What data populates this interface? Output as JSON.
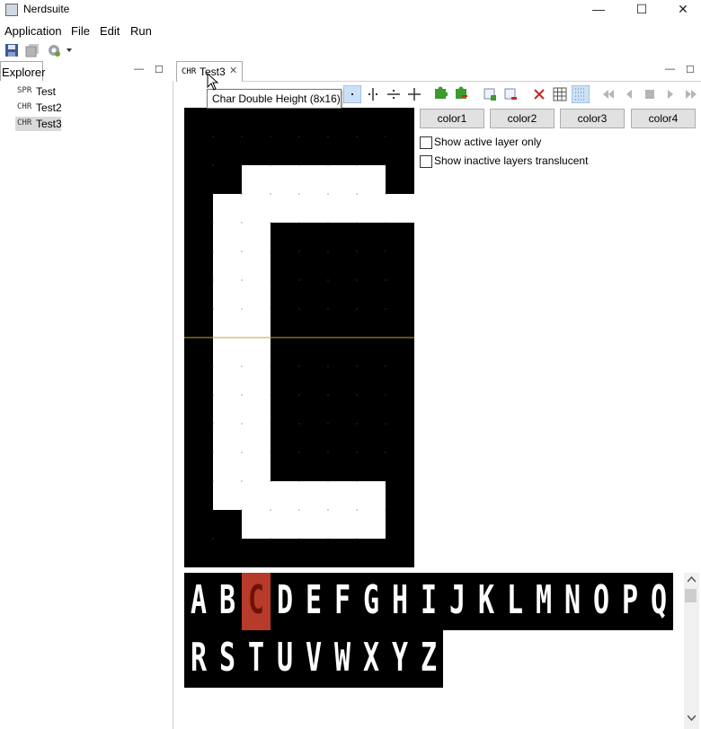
{
  "window": {
    "title": "Nerdsuite",
    "minimize_glyph": "—",
    "maximize_glyph": "☐",
    "close_glyph": "✕"
  },
  "menu": [
    "Application",
    "File",
    "Edit",
    "Run"
  ],
  "toolbar_icons": [
    "save-icon",
    "save-all-icon",
    "run-config-icon",
    "dropdown-arrow-icon"
  ],
  "explorer": {
    "tab_label": "Explorer",
    "minimize_glyph": "—",
    "maximize_glyph": "☐",
    "items": [
      {
        "tag": "SPR",
        "name": "Test"
      },
      {
        "tag": "CHR",
        "name": "Test2"
      },
      {
        "tag": "CHR",
        "name": "Test3"
      }
    ]
  },
  "editor": {
    "tab_tag": "CHR",
    "tab_name": "Test3",
    "tab_close_glyph": "✕",
    "minimize_glyph": "—",
    "maximize_glyph": "☐",
    "tooltip": "Char Double Height (8x16)",
    "color_buttons": [
      "color1",
      "color2",
      "color3",
      "color4"
    ],
    "options": [
      "Show active layer only",
      "Show inactive layers translucent"
    ],
    "toolbar_icons": [
      "pixel-tool-icon",
      "mirror-vertical-icon",
      "mirror-horizontal-icon",
      "mirror-both-icon",
      "puzzle-icon",
      "puzzle-remove-icon",
      "add-layer-icon",
      "remove-layer-icon",
      "delete-icon",
      "grid-icon",
      "pixel-grid-icon",
      "first-frame-icon",
      "prev-frame-icon",
      "stop-icon",
      "play-icon",
      "last-frame-icon"
    ],
    "glyph_bitmap": [
      "00000000",
      "00000000",
      "00111110",
      "01111111",
      "01100000",
      "01100000",
      "01100000",
      "01100000",
      "01100000",
      "01100000",
      "01100000",
      "01100000",
      "01100000",
      "01111110",
      "00111110",
      "00000000"
    ],
    "colors": {
      "pixel_on": "#ffffff",
      "pixel_off": "#000000",
      "divider": "#c8a23c",
      "selected_char": "#b83a2a"
    }
  },
  "charset": {
    "row1": [
      "A",
      "B",
      "C",
      "D",
      "E",
      "F",
      "G",
      "H",
      "I",
      "J",
      "K",
      "L",
      "M",
      "N",
      "O",
      "P",
      "Q"
    ],
    "row2": [
      "R",
      "S",
      "T",
      "U",
      "V",
      "W",
      "X",
      "Y",
      "Z"
    ],
    "selected": "C"
  }
}
